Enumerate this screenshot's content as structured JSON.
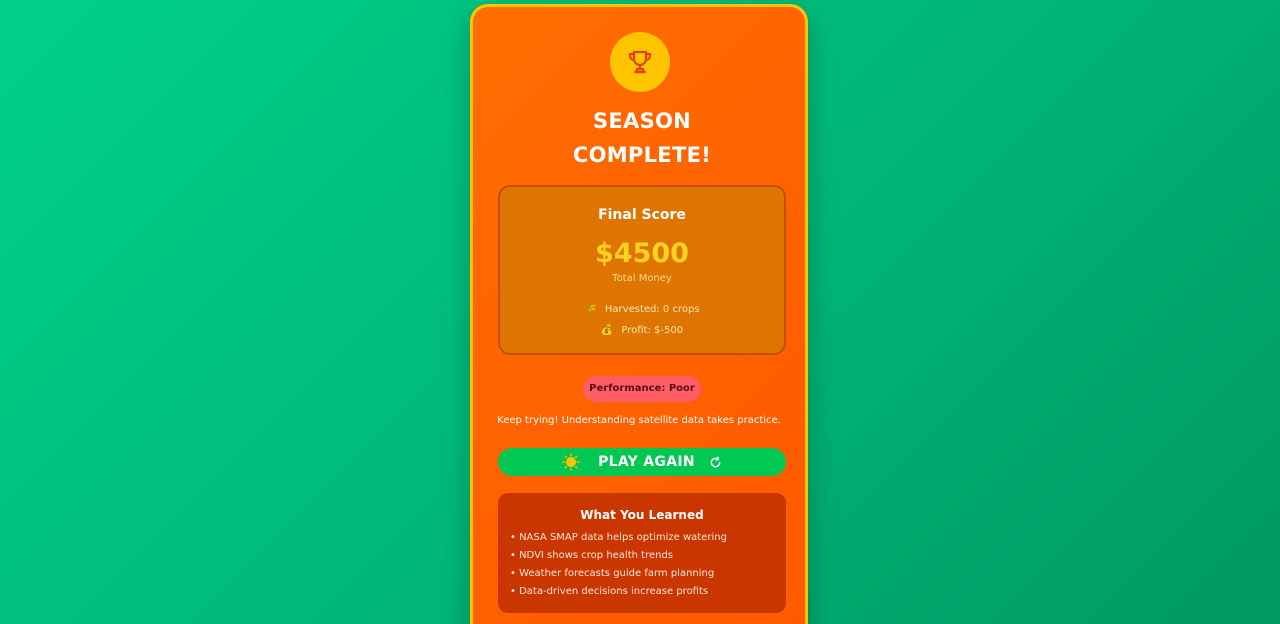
{
  "title_line1": "SEASON",
  "title_line2": "COMPLETE!",
  "score": {
    "heading": "Final Score",
    "value": "$4500",
    "sub": "Total Money",
    "harvested": "Harvested: 0 crops",
    "profit": "Profit: $-500"
  },
  "performance": "Performance: Poor",
  "encouragement": "Keep trying! Understanding satellite data takes practice.",
  "play_again": "PLAY AGAIN",
  "learned": {
    "title": "What You Learned",
    "items": [
      "• NASA SMAP data helps optimize watering",
      "• NDVI shows crop health trends",
      "• Weather forecasts guide farm planning",
      "• Data-driven decisions increase profits"
    ]
  },
  "icons": {
    "trophy": "trophy-icon",
    "harvest": "wheat-icon",
    "profit": "money-bag-icon",
    "play": "sun-icon",
    "restart": "refresh-icon"
  },
  "colors": {
    "background": "#00c080",
    "card": "#ff6600",
    "card_border": "#ffc400",
    "score_value": "#ffd21f",
    "badge": "#ff5e66",
    "play_button": "#00c853",
    "learn_box": "#c93600"
  }
}
